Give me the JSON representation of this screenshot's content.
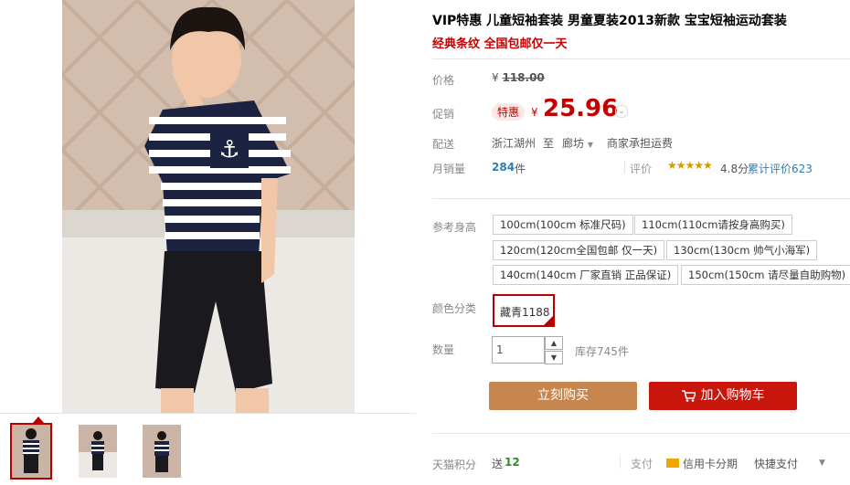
{
  "product": {
    "title": "VIP特惠 儿童短袖套装 男童夏装2013新款 宝宝短袖运动套装",
    "subtitle": "经典条纹 全国包邮仅一天"
  },
  "price": {
    "label": "价格",
    "currency": "¥",
    "original": "118.00",
    "promo_label": "促销",
    "promo_badge": "特惠",
    "current": "25.96"
  },
  "shipping": {
    "label": "配送",
    "from": "浙江湖州",
    "to_word": "至",
    "to": "廊坊",
    "note": "商家承担运费"
  },
  "sales": {
    "label": "月销量",
    "count": "284",
    "unit": "件",
    "review_label": "评价",
    "stars": "★★★★★",
    "rating": "4.8分",
    "review_text": "累计评价623"
  },
  "sizes": {
    "label": "参考身高",
    "options": [
      "100cm(100cm 标准尺码)",
      "110cm(110cm请按身高购买)",
      "120cm(120cm全国包邮 仅一天)",
      "130cm(130cm 帅气小海军)",
      "140cm(140cm 厂家直销 正品保证)",
      "150cm(150cm 请尽量自助购物)"
    ]
  },
  "color": {
    "label": "颜色分类",
    "selected": "藏青1188"
  },
  "quantity": {
    "label": "数量",
    "value": "1",
    "stock": "库存745件"
  },
  "buttons": {
    "buy_now": "立刻购买",
    "add_to_cart": "加入购物车"
  },
  "footer": {
    "points_label": "天猫积分",
    "points_prefix": "送",
    "points_value": "12",
    "pay_label": "支付",
    "credit": "信用卡分期",
    "quick_pay": "快捷支付"
  },
  "colors": {
    "accent_red": "#c40000",
    "buy_button": "#c8864f",
    "cart_button": "#c8160d"
  }
}
